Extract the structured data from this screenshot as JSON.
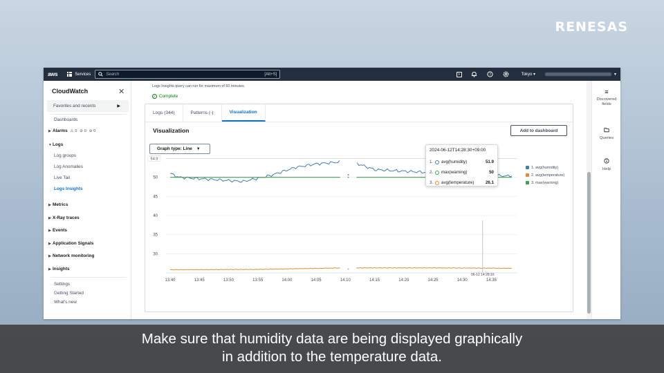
{
  "brand": {
    "logo_text": "RENESAS"
  },
  "topnav": {
    "logo": "aws",
    "services_label": "Services",
    "search_placeholder": "Search",
    "search_shortcut": "[Alt+S]",
    "region": "Tokyo",
    "icons": [
      "cloudshell-icon",
      "bell-icon",
      "help-icon",
      "settings-icon"
    ]
  },
  "sidebar": {
    "title": "CloudWatch",
    "favorites": "Favorites and recents",
    "items": [
      {
        "label": "Dashboards"
      },
      {
        "label": "Alarms",
        "badges": [
          "0",
          "0",
          "0"
        ]
      },
      {
        "label": "Logs"
      },
      {
        "label": "Log groups"
      },
      {
        "label": "Log Anomalies"
      },
      {
        "label": "Live Tail"
      },
      {
        "label": "Logs Insights"
      },
      {
        "label": "Metrics"
      },
      {
        "label": "X-Ray traces"
      },
      {
        "label": "Events"
      },
      {
        "label": "Application Signals"
      },
      {
        "label": "Network monitoring"
      },
      {
        "label": "Insights"
      },
      {
        "label": "Settings"
      },
      {
        "label": "Getting Started"
      },
      {
        "label": "What's new"
      }
    ]
  },
  "main": {
    "notice": "Logs Insights query can run for maximum of 60 minutes.",
    "status": "Complete",
    "tabs": [
      {
        "label": "Logs (344)"
      },
      {
        "label": "Patterns (-)"
      },
      {
        "label": "Visualization"
      }
    ],
    "viz_title": "Visualization",
    "add_button": "Add to dashboard",
    "graph_type": "Graph type: Line",
    "tooltip": {
      "time": "2024-06-12T14:28:30+09:00",
      "rows": [
        {
          "num": "1.",
          "name": "avg(humidity)",
          "value": "51.9"
        },
        {
          "num": "2.",
          "name": "max(warning)",
          "value": "50"
        },
        {
          "num": "3.",
          "name": "avg(temperature)",
          "value": "26.1"
        }
      ]
    }
  },
  "rail": {
    "items": [
      {
        "label": "Discovered fields"
      },
      {
        "label": "Queries"
      },
      {
        "label": "Help"
      }
    ]
  },
  "caption": {
    "line1": "Make sure that humidity data are being displayed graphically",
    "line2": "in addition to the temperature data."
  },
  "colors": {
    "humidity": "#3f7db5",
    "temperature": "#e68a2e",
    "warning": "#3ea14f",
    "accent": "#0972d3"
  },
  "chart_data": {
    "type": "line",
    "x": [
      "13:40",
      "13:45",
      "13:50",
      "13:55",
      "14:00",
      "14:05",
      "14:10",
      "14:15",
      "14:20",
      "14:25",
      "14:30",
      "14:35"
    ],
    "ylim": [
      25,
      55
    ],
    "y_ticks": [
      "30",
      "35",
      "40",
      "45",
      "50"
    ],
    "threshold_label": "54.9",
    "cursor_label": "06-12 14:28:16",
    "series": [
      {
        "name": "1. avg(humidity)",
        "color": "#3f7db5",
        "points": [
          [
            0,
            51.0
          ],
          [
            0.3,
            50.0
          ],
          [
            1.5,
            49.4
          ],
          [
            2.5,
            48.9
          ],
          [
            3.4,
            50.4
          ],
          [
            4.3,
            52.6
          ],
          [
            5.0,
            53.5
          ],
          [
            5.8,
            54.0
          ],
          [
            6.4,
            53.6
          ],
          [
            7.0,
            52.0
          ],
          [
            8.0,
            51.6
          ],
          [
            9.0,
            51.2
          ],
          [
            10.0,
            50.8
          ],
          [
            11.0,
            50.5
          ],
          [
            11.7,
            50.3
          ]
        ],
        "gap": [
          5.85,
          6.35
        ]
      },
      {
        "name": "2. avg(temperature)",
        "color": "#e68a2e",
        "points": [
          [
            0,
            25.8
          ],
          [
            3,
            25.9
          ],
          [
            6,
            26.3
          ],
          [
            9,
            26.3
          ],
          [
            11.7,
            26.2
          ]
        ],
        "gap": [
          5.85,
          6.35
        ]
      },
      {
        "name": "3. max(warning)",
        "color": "#3ea14f",
        "points": [
          [
            0,
            50
          ],
          [
            11.7,
            50
          ]
        ],
        "gap": [
          5.85,
          6.35
        ]
      }
    ]
  }
}
